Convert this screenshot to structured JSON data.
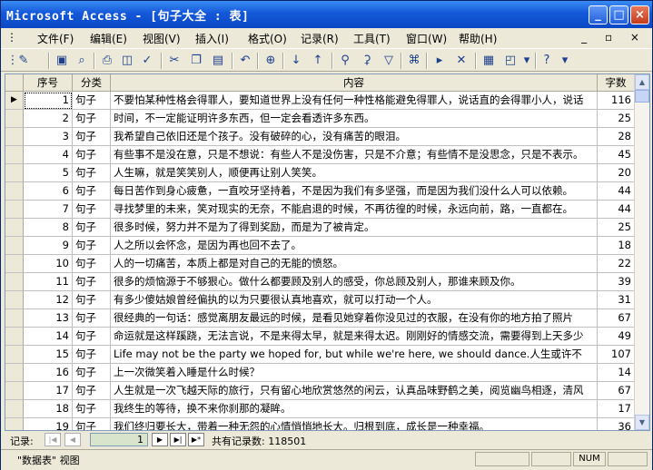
{
  "window": {
    "title": "Microsoft Access - [句子大全 : 表]"
  },
  "menu": {
    "items": [
      "文件(F)",
      "编辑(E)",
      "视图(V)",
      "插入(I)",
      "格式(O)",
      "记录(R)",
      "工具(T)",
      "窗口(W)",
      "帮助(H)"
    ],
    "mdi_controls": "_ ▫ ×"
  },
  "toolbar": {
    "icons": [
      "design-view-icon",
      "save-icon",
      "search-icon",
      "print-icon",
      "print-preview-icon",
      "spelling-icon",
      "cut-icon",
      "copy-icon",
      "paste-icon",
      "undo-icon",
      "hyperlink-icon",
      "sort-ascending-icon",
      "sort-descending-icon",
      "filter-by-selection-icon",
      "filter-by-form-icon",
      "apply-filter-icon",
      "find-icon",
      "new-record-icon",
      "delete-record-icon",
      "database-window-icon",
      "new-object-icon",
      "help-icon"
    ]
  },
  "table": {
    "columns": [
      "序号",
      "分类",
      "内容",
      "字数"
    ],
    "rows": [
      [
        "1",
        "句子",
        "不要怕某种性格会得罪人，要知道世界上没有任何一种性格能避免得罪人，说话直的会得罪小人，说话",
        "116"
      ],
      [
        "2",
        "句子",
        "时间，不一定能证明许多东西，但一定会看透许多东西。",
        "25"
      ],
      [
        "3",
        "句子",
        "我希望自己依旧还是个孩子。没有破碎的心，没有痛苦的眼泪。",
        "28"
      ],
      [
        "4",
        "句子",
        "有些事不是没在意，只是不想说：有些人不是没伤害，只是不介意；有些情不是没思念，只是不表示。",
        "45"
      ],
      [
        "5",
        "句子",
        "人生嘛，就是笑笑别人，顺便再让别人笑笑。",
        "20"
      ],
      [
        "6",
        "句子",
        "每日苦作到身心疲惫，一直咬牙坚持着，不是因为我们有多坚强，而是因为我们没什么人可以依赖。",
        "44"
      ],
      [
        "7",
        "句子",
        "寻找梦里的未来，笑对现实的无奈，不能启退的时候，不再彷徨的时候，永远向前，路，一直都在。",
        "44"
      ],
      [
        "8",
        "句子",
        "很多时候，努力并不是为了得到奖励，而是为了被肯定。",
        "25"
      ],
      [
        "9",
        "句子",
        "人之所以会怀念，是因为再也回不去了。",
        "18"
      ],
      [
        "10",
        "句子",
        "人的一切痛苦，本质上都是对自己的无能的愤怒。",
        "22"
      ],
      [
        "11",
        "句子",
        "很多的烦恼源于不够狠心。做什么都要顾及别人的感受，你总顾及别人，那谁来顾及你。",
        "39"
      ],
      [
        "12",
        "句子",
        "有多少傻姑娘曾经偏执的以为只要很认真地喜欢，就可以打动一个人。",
        "31"
      ],
      [
        "13",
        "句子",
        "很经典的一句话：感觉离朋友最远的时候，是看见她穿着你没见过的衣服，在没有你的地方拍了照片",
        "67"
      ],
      [
        "14",
        "句子",
        "命运就是这样蹊跷，无法言说，不是来得太早，就是来得太迟。刚刚好的情感交流，需要得到上天多少",
        "49"
      ],
      [
        "15",
        "句子",
        "Life may not be the party we hoped for, but while we're here, we should dance.人生或许不",
        "107"
      ],
      [
        "16",
        "句子",
        "上一次微笑着入睡是什么时候？",
        "14"
      ],
      [
        "17",
        "句子",
        "人生就是一次飞越天际的旅行，只有留心地欣赏悠然的闲云，认真品味野鹤之美，阅览幽鸟相逐，清风",
        "67"
      ],
      [
        "18",
        "句子",
        "我终生的等待，换不来你刹那的凝眸。",
        "17"
      ],
      [
        "19",
        "句子",
        "我们终归要长大，带着一种无怨的心情悄悄地长大。归根到底，成长是一种幸福。",
        "36"
      ]
    ]
  },
  "navigation": {
    "label": "记录:",
    "current": "1",
    "total_text": "共有记录数: 118501"
  },
  "status": {
    "view": "\"数据表\" 视图",
    "indicator": "NUM"
  }
}
